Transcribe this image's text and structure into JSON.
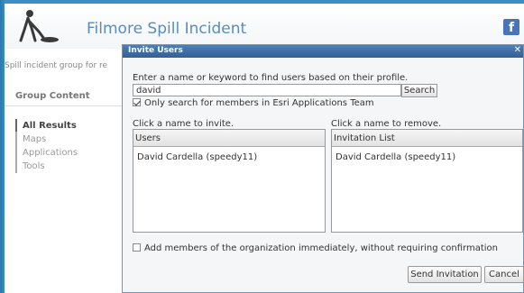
{
  "header": {
    "title": "Filmore Spill Incident",
    "logo_icon": "spill-worker-logo-icon",
    "social_icon": "facebook-icon",
    "social_label": "f"
  },
  "sidebar": {
    "subtitle": "Spill incident group for re",
    "section_title": "Group Content",
    "items": [
      {
        "label": "All Results",
        "active": true
      },
      {
        "label": "Maps",
        "active": false
      },
      {
        "label": "Applications",
        "active": false
      },
      {
        "label": "Tools",
        "active": false
      }
    ]
  },
  "dialog": {
    "title": "Invite Users",
    "instruction": "Enter a name or keyword to find users based on their profile.",
    "search": {
      "value": "david",
      "button_label": "Search"
    },
    "only_members": {
      "checked": true,
      "label": "Only search for members in Esri Applications Team"
    },
    "users": {
      "hint": "Click a name to invite.",
      "header": "Users",
      "rows": [
        "David Cardella (speedy11)"
      ]
    },
    "invitations": {
      "hint": "Click a name to remove.",
      "header": "Invitation List",
      "rows": [
        "David Cardella (speedy11)"
      ]
    },
    "add_members": {
      "checked": false,
      "label": "Add members of the organization immediately, without requiring confirmation"
    },
    "send_label": "Send Invitation",
    "cancel_label": "Cancel"
  },
  "colors": {
    "frame": "#3b8fc6",
    "title": "#5b8db8",
    "dialog_titlebar": "#335f95"
  }
}
